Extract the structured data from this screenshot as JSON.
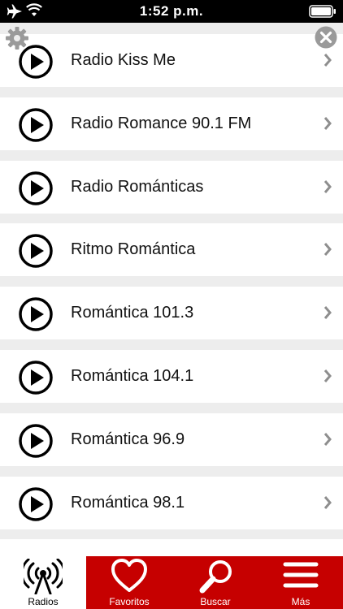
{
  "status_bar": {
    "time": "1:52 p.m.",
    "icons": [
      "airplane-icon",
      "wifi-icon",
      "battery-icon"
    ]
  },
  "controls": {
    "settings_icon": "gear-icon",
    "close_icon": "close-icon"
  },
  "stations": [
    {
      "name": "Radio Kiss Me"
    },
    {
      "name": "Radio Romance 90.1 FM"
    },
    {
      "name": "Radio Románticas"
    },
    {
      "name": "Ritmo Romántica"
    },
    {
      "name": "Romántica 101.3"
    },
    {
      "name": "Romántica 104.1"
    },
    {
      "name": "Romántica 96.9"
    },
    {
      "name": "Romántica 98.1"
    }
  ],
  "tabs": [
    {
      "label": "Radios",
      "icon": "radio-tower-icon",
      "active": true
    },
    {
      "label": "Favoritos",
      "icon": "heart-icon",
      "active": false
    },
    {
      "label": "Buscar",
      "icon": "search-icon",
      "active": false
    },
    {
      "label": "Más",
      "icon": "menu-icon",
      "active": false
    }
  ],
  "colors": {
    "tab_bar": "#c60000",
    "row_background": "#ffffff",
    "list_background": "#ededed",
    "chevron": "#8e8e8e"
  }
}
